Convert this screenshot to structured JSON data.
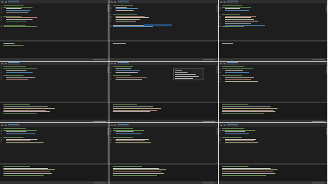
{
  "panes": [
    {
      "tab_label": "",
      "status_text": "",
      "console_prompt": ""
    },
    {
      "tab_label": "",
      "status_text": "",
      "console_prompt": ""
    },
    {
      "tab_label": "",
      "status_text": "",
      "console_prompt": ""
    },
    {
      "tab_label": "",
      "status_text": "",
      "console_prompt": ""
    },
    {
      "tab_label": "",
      "status_text": "",
      "console_prompt": ""
    },
    {
      "tab_label": "",
      "status_text": "",
      "console_prompt": ""
    },
    {
      "tab_label": "",
      "status_text": "",
      "console_prompt": ""
    },
    {
      "tab_label": "",
      "status_text": "",
      "console_prompt": ""
    },
    {
      "tab_label": "",
      "status_text": "",
      "console_prompt": ""
    }
  ],
  "theme": {
    "background": "#1e1e1e",
    "tab_bar": "#2d2d30",
    "comment_color": "#6a9955",
    "string_color": "#ce9178",
    "keyword_color": "#569cd6",
    "function_color": "#dcdcaa",
    "plain_color": "#d4d4d4",
    "selection_color": "#264f78"
  }
}
